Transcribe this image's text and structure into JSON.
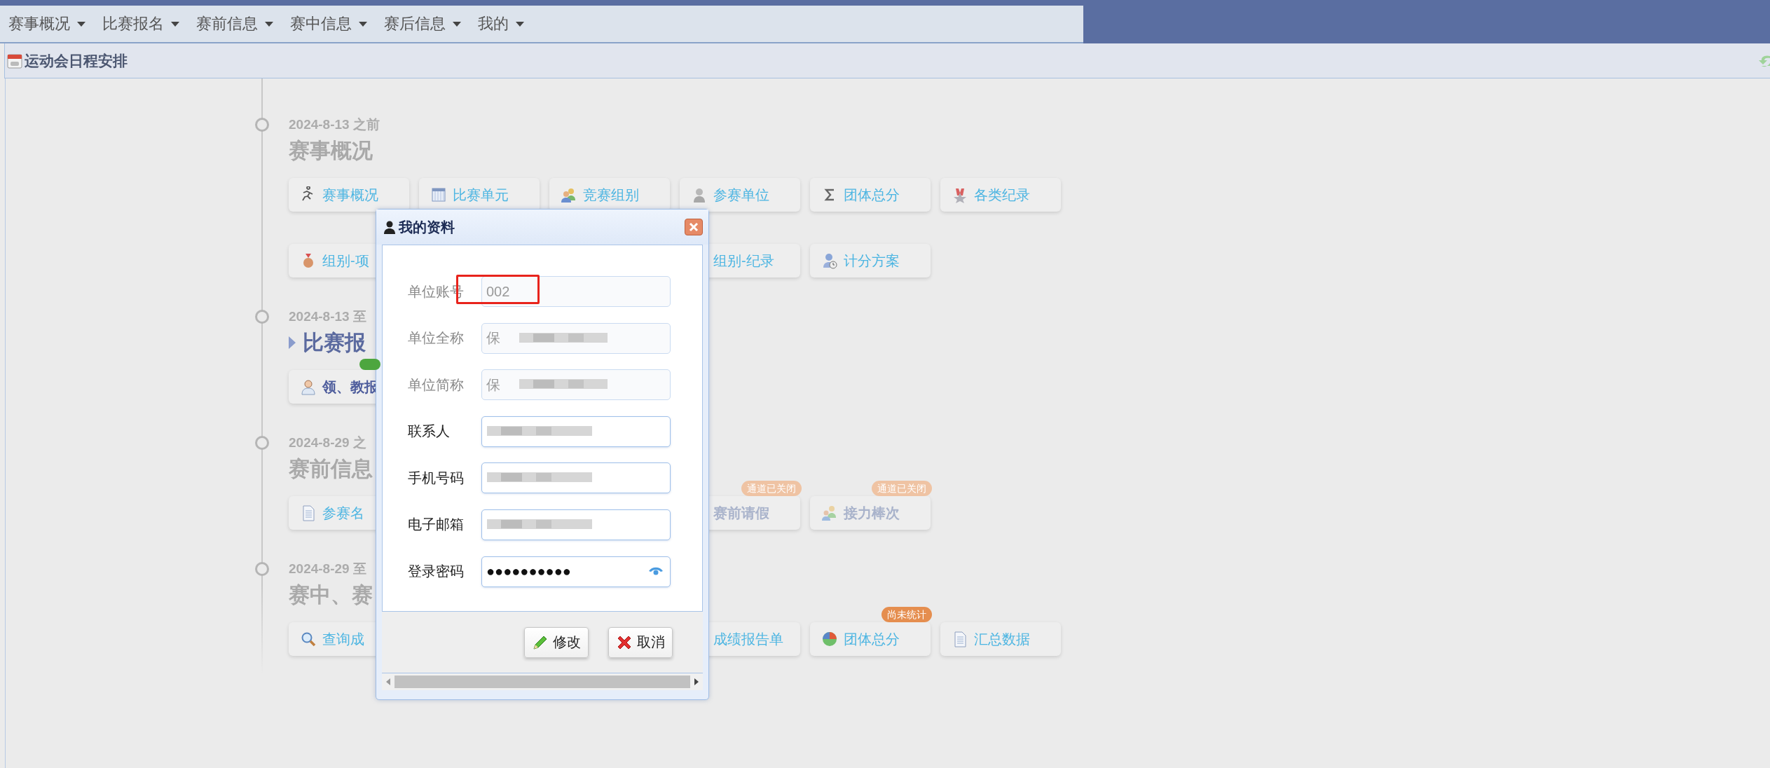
{
  "menu": [
    "赛事概况",
    "比赛报名",
    "赛前信息",
    "赛中信息",
    "赛后信息",
    "我的"
  ],
  "panel": {
    "title": "运动会日程安排"
  },
  "timeline": [
    {
      "date": "2024-8-13 之前",
      "heading": "赛事概况",
      "current": false,
      "rows": [
        [
          {
            "label": "赛事概况",
            "disabled": false
          },
          {
            "label": "比赛单元",
            "disabled": false
          },
          {
            "label": "竞赛组别",
            "disabled": false
          },
          {
            "label": "参赛单位",
            "disabled": false
          },
          {
            "label": "团体总分",
            "disabled": false
          },
          {
            "label": "各类纪录",
            "disabled": false
          }
        ],
        [
          {
            "label": "组别-项",
            "disabled": false
          },
          null,
          null,
          {
            "label": "组别-纪录",
            "disabled": false
          },
          {
            "label": "计分方案",
            "disabled": false
          }
        ]
      ]
    },
    {
      "date": "2024-8-13 至",
      "heading": "比赛报",
      "current": true,
      "rows": [
        [
          {
            "label": "领、教报",
            "disabled": false,
            "badge": {
              "kind": "done"
            }
          }
        ]
      ]
    },
    {
      "date": "2024-8-29 之",
      "heading": "赛前信息",
      "current": false,
      "rows": [
        [
          {
            "label": "参赛名",
            "disabled": false
          },
          null,
          null,
          {
            "label": "赛前请假",
            "disabled": true,
            "badge": {
              "kind": "closed",
              "text": "通道已关闭"
            }
          },
          {
            "label": "接力棒次",
            "disabled": true,
            "badge": {
              "kind": "closed",
              "text": "通道已关闭"
            }
          }
        ]
      ]
    },
    {
      "date": "2024-8-29 至",
      "heading": "赛中、赛",
      "current": false,
      "rows": [
        [
          {
            "label": "查询成",
            "disabled": false
          },
          null,
          null,
          {
            "label": "成绩报告单",
            "disabled": false
          },
          {
            "label": "团体总分",
            "disabled": false,
            "badge": {
              "kind": "pending",
              "text": "尚未统计"
            }
          },
          {
            "label": "汇总数据",
            "disabled": false
          }
        ]
      ]
    }
  ],
  "dialog": {
    "title": "我的资料",
    "fields": [
      {
        "label": "单位账号",
        "value": "002",
        "disabled": true,
        "highlighted": true,
        "redacted": false
      },
      {
        "label": "单位全称",
        "value": "保",
        "disabled": true,
        "highlighted": false,
        "redacted": true
      },
      {
        "label": "单位简称",
        "value": "保",
        "disabled": true,
        "highlighted": false,
        "redacted": true
      },
      {
        "label": "联系人",
        "disabled": false,
        "highlighted": false,
        "redacted": true
      },
      {
        "label": "手机号码",
        "disabled": false,
        "highlighted": false,
        "redacted": true
      },
      {
        "label": "电子邮箱",
        "disabled": false,
        "highlighted": false,
        "redacted": true
      },
      {
        "label": "登录密码",
        "value": "●●●●●●●●●●",
        "kind": "password",
        "disabled": false,
        "highlighted": false,
        "redacted": false
      }
    ],
    "buttons": [
      "修改",
      "取消"
    ]
  }
}
